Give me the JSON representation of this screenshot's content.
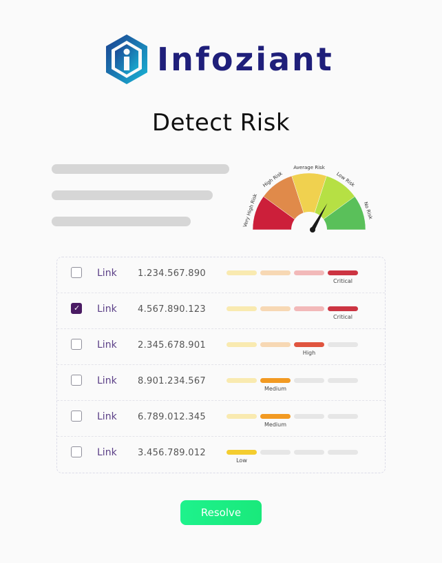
{
  "brand": {
    "name": "Infoziant",
    "text_color": "#1f1f7a",
    "mark_colors": [
      "#1c3f8f",
      "#19b6d6"
    ]
  },
  "heading": "Detect Risk",
  "gauge": {
    "labels": [
      "Very High Risk",
      "High Risk",
      "Average Risk",
      "Low Risk",
      "No Risk"
    ],
    "colors": [
      "#cc1f3a",
      "#e08a4a",
      "#f0d14f",
      "#b6e044",
      "#5ac05a"
    ],
    "needle_level": "Low Risk"
  },
  "table": {
    "rows": [
      {
        "checked": false,
        "link": "Link",
        "number": "1.234.567.890",
        "risk": "Critical",
        "level": 4
      },
      {
        "checked": true,
        "link": "Link",
        "number": "4.567.890.123",
        "risk": "Critical",
        "level": 4
      },
      {
        "checked": false,
        "link": "Link",
        "number": "2.345.678.901",
        "risk": "High",
        "level": 3
      },
      {
        "checked": false,
        "link": "Link",
        "number": "8.901.234.567",
        "risk": "Medium",
        "level": 2
      },
      {
        "checked": false,
        "link": "Link",
        "number": "6.789.012.345",
        "risk": "Medium",
        "level": 2
      },
      {
        "checked": false,
        "link": "Link",
        "number": "3.456.789.012",
        "risk": "Low",
        "level": 1
      }
    ],
    "bar_colors": {
      "faint": [
        "#f9eab0",
        "#f7d8b4",
        "#f2b9b9",
        "#e2e2e2"
      ],
      "gray": "#e6e6e6",
      "active": {
        "Low": "#f4cd2f",
        "Medium": "#f29a22",
        "High": "#e0553f",
        "Critical": "#cc3442"
      }
    }
  },
  "resolve_button": {
    "label": "Resolve",
    "color": "#1ef28c"
  }
}
